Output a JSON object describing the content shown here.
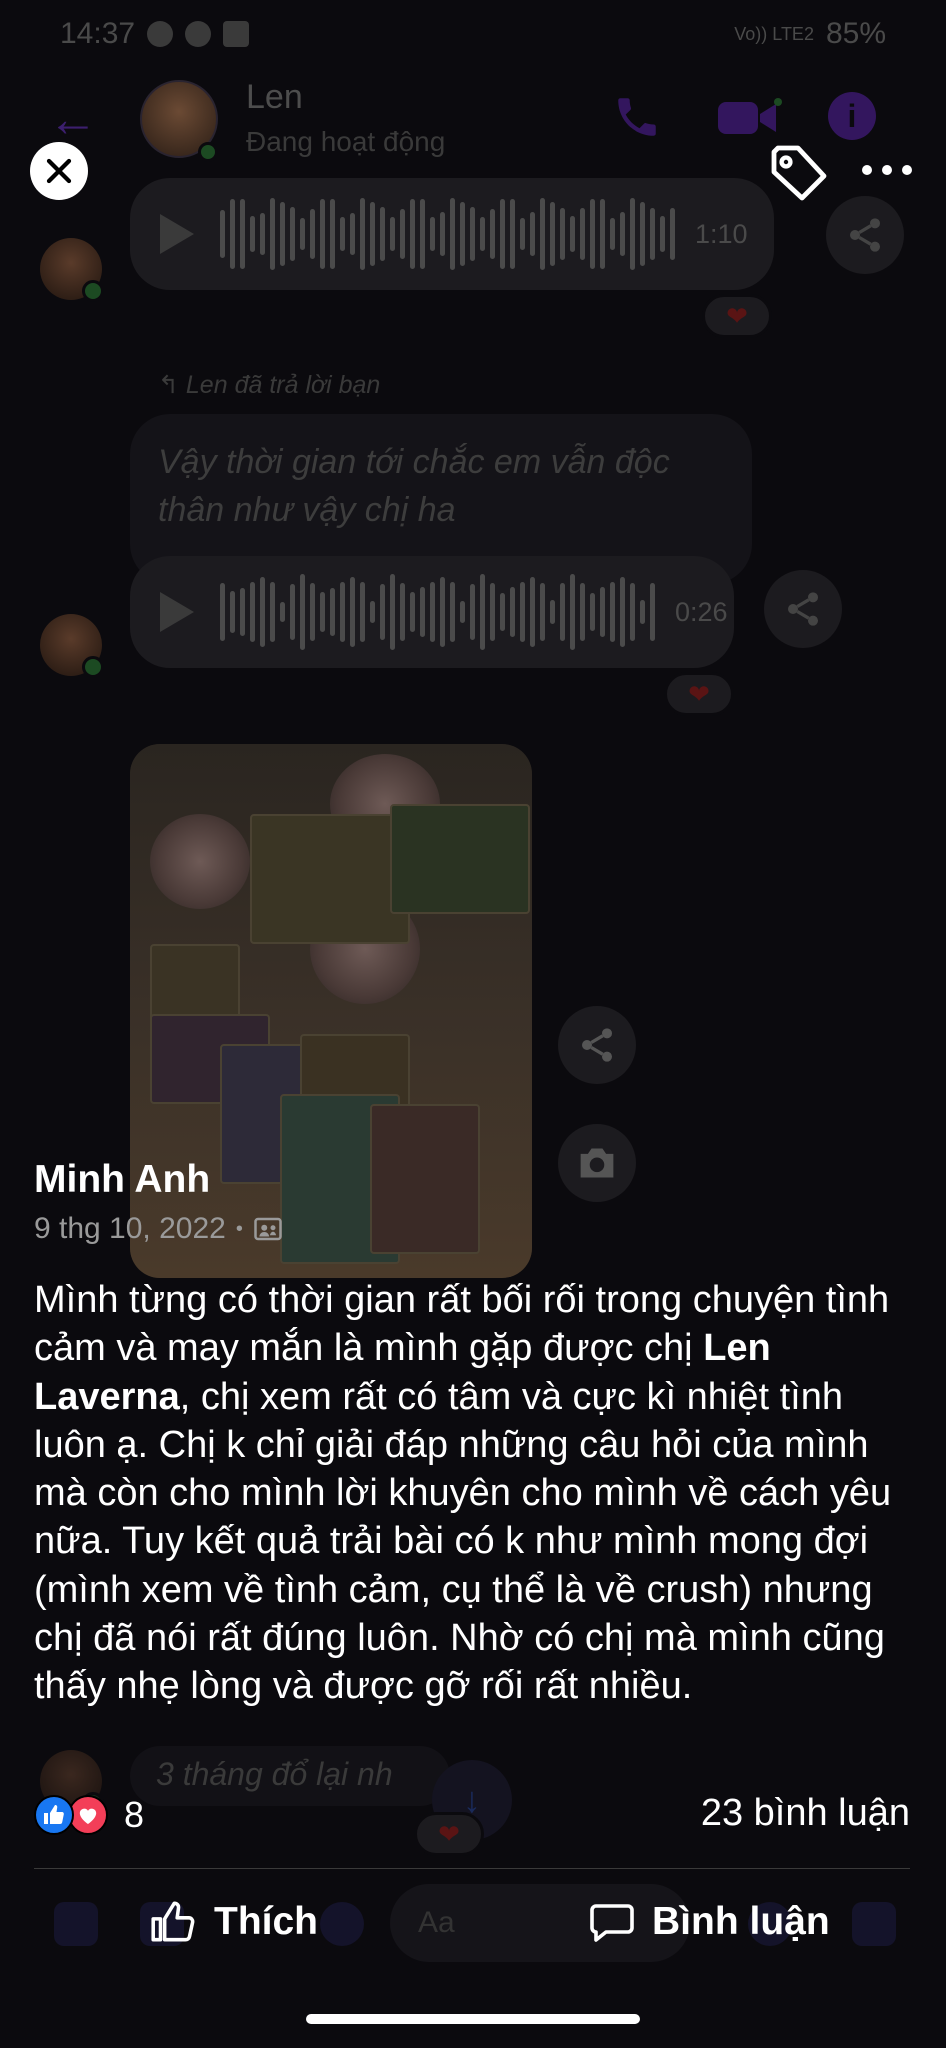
{
  "status_bar": {
    "time": "14:37",
    "battery": "85%",
    "network": "Vo)) LTE2"
  },
  "chat": {
    "contact_name": "Len",
    "contact_status": "Đang hoạt động",
    "voice_1_duration": "1:10",
    "reply_label": "Len đã trả lời bạn",
    "quoted_text": "Vậy thời gian tới chắc em vẫn độc thân như vậy chị ha",
    "voice_2_duration": "0:26",
    "faded_bubble_text": "3 tháng đổ lại nh",
    "composer_placeholder": "Aa"
  },
  "post": {
    "author": "Minh Anh",
    "date": "9 thg 10, 2022",
    "caption_parts": {
      "p1": "Mình từng có thời gian rất bối rối trong chuyện tình cảm và may mắn là mình gặp được chị ",
      "bold_name": "Len Laverna",
      "p2": ", chị xem rất có tâm và cực kì nhiệt tình luôn ạ. Chị k chỉ giải đáp những câu hỏi của mình mà còn cho mình lời khuyên cho mình về cách yêu nữa. Tuy kết quả trải bài có k như mình mong đợi (mình xem về tình cảm, cụ thể là về crush) nhưng chị đã nói rất đúng luôn. Nhờ có chị mà mình cũng thấy nhẹ lòng và được gỡ rối rất nhiều."
    },
    "reaction_count": "8",
    "comment_count": "23 bình luận",
    "like_label": "Thích",
    "comment_label": "Bình luận"
  },
  "colors": {
    "like_blue": "#1877f2",
    "love_red": "#f33e58",
    "messenger_purple": "#3c1f6e"
  },
  "icons": [
    "close-icon",
    "tag-icon",
    "more-icon",
    "share-icon",
    "camera-icon",
    "play-icon",
    "thumbs-up-icon",
    "comment-icon",
    "heart-icon",
    "privacy-icon"
  ]
}
